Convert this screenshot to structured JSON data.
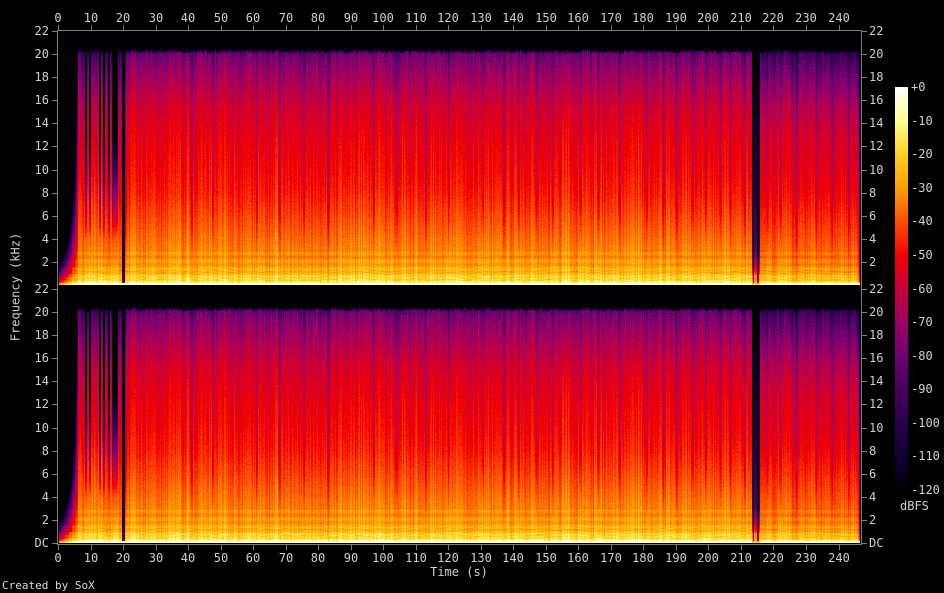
{
  "credit": "Created by SoX",
  "chart_data": {
    "type": "heatmap",
    "subtype": "audio-spectrogram",
    "channels": 2,
    "channel_names": [
      "channel-1",
      "channel-2"
    ],
    "x_axis": {
      "label": "Time (s)",
      "min": 0,
      "max": 246.9,
      "ticks": [
        0,
        10,
        20,
        30,
        40,
        50,
        60,
        70,
        80,
        90,
        100,
        110,
        120,
        130,
        140,
        150,
        160,
        170,
        180,
        190,
        200,
        210,
        220,
        230,
        240
      ]
    },
    "y_axis": {
      "label": "Frequency (kHz)",
      "min": 0,
      "max": 22,
      "ticks": [
        "22",
        "20",
        "18",
        "16",
        "14",
        "12",
        "10",
        "8",
        "6",
        "4",
        "2"
      ],
      "dc_label": "DC"
    },
    "colorbar": {
      "label": "dBFS",
      "max": 0,
      "min": -120,
      "ticks": [
        "+0",
        "-10",
        "-20",
        "-30",
        "-40",
        "-50",
        "-60",
        "-70",
        "-80",
        "-90",
        "-100",
        "-110",
        "-120"
      ],
      "palette": [
        [
          0,
          "#ffffff"
        ],
        [
          -10,
          "#ffff8c"
        ],
        [
          -20,
          "#ffd020"
        ],
        [
          -30,
          "#ff9d00"
        ],
        [
          -40,
          "#ff4f00"
        ],
        [
          -50,
          "#f20000"
        ],
        [
          -60,
          "#c4003e"
        ],
        [
          -70,
          "#9c0063"
        ],
        [
          -80,
          "#6e0172"
        ],
        [
          -90,
          "#46005d"
        ],
        [
          -100,
          "#28004d"
        ],
        [
          -110,
          "#100031"
        ],
        [
          -120,
          "#000005"
        ]
      ]
    },
    "frequency_profile_db": [
      [
        0,
        -5
      ],
      [
        0.2,
        -12
      ],
      [
        0.6,
        -20
      ],
      [
        1.2,
        -26
      ],
      [
        2,
        -30
      ],
      [
        3,
        -33
      ],
      [
        4.5,
        -37
      ],
      [
        6,
        -41
      ],
      [
        8,
        -46
      ],
      [
        10,
        -49
      ],
      [
        12,
        -51
      ],
      [
        14,
        -54
      ],
      [
        15.5,
        -57
      ],
      [
        17,
        -63
      ],
      [
        18.5,
        -70
      ],
      [
        19.5,
        -76
      ],
      [
        20.1,
        -82
      ],
      [
        20.35,
        -100
      ],
      [
        20.5,
        -124
      ],
      [
        22,
        -124
      ]
    ],
    "events": {
      "silence_end_s": 0.3,
      "fade_in_end_s": 6.2,
      "intro_end_s": 19.6,
      "body_start_s": 20.4,
      "breakdown_s": [
        213.2,
        215.6
      ],
      "breakdown_black_s": [
        213.6,
        215.1
      ],
      "outro_start_s": 215.6,
      "fade_out_start_s": 245.8,
      "end_s": 246.6,
      "lowpass_cutoff_khz": 20.35
    },
    "dark_streaks_s": [
      20.6,
      41,
      47.5,
      61,
      68,
      75.5,
      83,
      97,
      104,
      113,
      120,
      130.5,
      137,
      141.5,
      147,
      152,
      160.5,
      166,
      172.5,
      181,
      186,
      190,
      195,
      199,
      203.5,
      206.5,
      211,
      218,
      222,
      227,
      233,
      238,
      243
    ]
  }
}
